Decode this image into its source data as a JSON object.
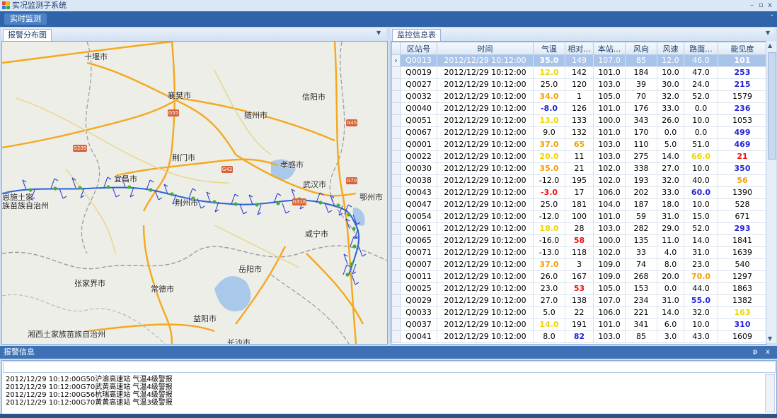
{
  "window": {
    "title": "实况监测子系统",
    "btn_min": "–",
    "btn_max": "▫",
    "btn_close": "x"
  },
  "ribbon": {
    "tab_label": "实时监测",
    "pin": "˄"
  },
  "map_panel": {
    "tab_label": "报警分布图",
    "menu_arrow": "▼",
    "cities": [
      "十堰市",
      "襄樊市",
      "信阳市",
      "随州市",
      "荆门市",
      "孝感市",
      "宜昌市",
      "武汉市",
      "鄂州市",
      "荆州市",
      "咸宁市",
      "岳阳市",
      "张家界市",
      "常德市",
      "益阳市",
      "湘西土家族苗族自治州",
      "长沙市",
      "恩施土家",
      "族苗族自治州"
    ],
    "shields": [
      "G55",
      "G45",
      "G209",
      "G42",
      "G70",
      "G316"
    ]
  },
  "table_panel": {
    "tab_label": "监控信息表",
    "menu_arrow": "▼",
    "row_pointer": "›",
    "columns": [
      "区站号",
      "时间",
      "气温",
      "相对...",
      "本站...",
      "风向",
      "风速",
      "路面...",
      "能见度"
    ],
    "rows": [
      [
        "Q0013",
        "2012/12/29 10:12:00",
        "35.0",
        "149",
        "107.0",
        "85",
        "12.0",
        "46.0",
        "101"
      ],
      [
        "Q0019",
        "2012/12/29 10:12:00",
        "12.0",
        "142",
        "101.0",
        "184",
        "10.0",
        "47.0",
        "253"
      ],
      [
        "Q0027",
        "2012/12/29 10:12:00",
        "25.0",
        "120",
        "103.0",
        "39",
        "30.0",
        "24.0",
        "215"
      ],
      [
        "Q0032",
        "2012/12/29 10:12:00",
        "34.0",
        "1",
        "105.0",
        "70",
        "32.0",
        "52.0",
        "1579"
      ],
      [
        "Q0040",
        "2012/12/29 10:12:00",
        "-8.0",
        "126",
        "101.0",
        "176",
        "33.0",
        "0.0",
        "236"
      ],
      [
        "Q0051",
        "2012/12/29 10:12:00",
        "13.0",
        "133",
        "100.0",
        "343",
        "26.0",
        "10.0",
        "1053"
      ],
      [
        "Q0067",
        "2012/12/29 10:12:00",
        "9.0",
        "132",
        "101.0",
        "170",
        "0.0",
        "0.0",
        "499"
      ],
      [
        "Q0001",
        "2012/12/29 10:12:00",
        "37.0",
        "65",
        "103.0",
        "110",
        "5.0",
        "51.0",
        "469"
      ],
      [
        "Q0022",
        "2012/12/29 10:12:00",
        "20.0",
        "11",
        "103.0",
        "275",
        "14.0",
        "66.0",
        "21"
      ],
      [
        "Q0030",
        "2012/12/29 10:12:00",
        "35.0",
        "21",
        "102.0",
        "338",
        "27.0",
        "10.0",
        "350"
      ],
      [
        "Q0038",
        "2012/12/29 10:12:00",
        "-12.0",
        "195",
        "102.0",
        "193",
        "32.0",
        "40.0",
        "56"
      ],
      [
        "Q0043",
        "2012/12/29 10:12:00",
        "-3.0",
        "17",
        "106.0",
        "202",
        "33.0",
        "60.0",
        "1390"
      ],
      [
        "Q0047",
        "2012/12/29 10:12:00",
        "25.0",
        "181",
        "104.0",
        "187",
        "18.0",
        "10.0",
        "528"
      ],
      [
        "Q0054",
        "2012/12/29 10:12:00",
        "-12.0",
        "100",
        "101.0",
        "59",
        "31.0",
        "15.0",
        "671"
      ],
      [
        "Q0061",
        "2012/12/29 10:12:00",
        "18.0",
        "28",
        "103.0",
        "282",
        "29.0",
        "52.0",
        "293"
      ],
      [
        "Q0065",
        "2012/12/29 10:12:00",
        "-16.0",
        "58",
        "100.0",
        "135",
        "11.0",
        "14.0",
        "1841"
      ],
      [
        "Q0071",
        "2012/12/29 10:12:00",
        "-13.0",
        "118",
        "102.0",
        "33",
        "4.0",
        "31.0",
        "1639"
      ],
      [
        "Q0007",
        "2012/12/29 10:12:00",
        "37.0",
        "3",
        "109.0",
        "74",
        "8.0",
        "23.0",
        "540"
      ],
      [
        "Q0011",
        "2012/12/29 10:12:00",
        "26.0",
        "167",
        "109.0",
        "268",
        "20.0",
        "70.0",
        "1297"
      ],
      [
        "Q0025",
        "2012/12/29 10:12:00",
        "23.0",
        "53",
        "105.0",
        "153",
        "0.0",
        "44.0",
        "1863"
      ],
      [
        "Q0029",
        "2012/12/29 10:12:00",
        "27.0",
        "138",
        "107.0",
        "234",
        "31.0",
        "55.0",
        "1382"
      ],
      [
        "Q0033",
        "2012/12/29 10:12:00",
        "5.0",
        "22",
        "106.0",
        "221",
        "14.0",
        "32.0",
        "163"
      ],
      [
        "Q0037",
        "2012/12/29 10:12:00",
        "14.0",
        "191",
        "101.0",
        "341",
        "6.0",
        "10.0",
        "310"
      ],
      [
        "Q0041",
        "2012/12/29 10:12:00",
        "8.0",
        "82",
        "103.0",
        "85",
        "3.0",
        "43.0",
        "1609"
      ]
    ],
    "highlights": {
      "orange": "#f5a000",
      "yellow": "#eed500",
      "blue": "#2323d9",
      "red": "#ee1111"
    }
  },
  "alarm_panel": {
    "title": "报警信息",
    "pin": "ᵽ",
    "close": "x",
    "lines": [
      "2012/12/29 10:12:00G50沪渝高速站 气温4级警报",
      "2012/12/29 10:12:00G70武黄高速站 气温4级警报",
      "2012/12/29 10:12:00G56杭瑞高速站 气温4级警报",
      "2012/12/29 10:12:00G70黄黄高速站 气温3级警报"
    ]
  }
}
